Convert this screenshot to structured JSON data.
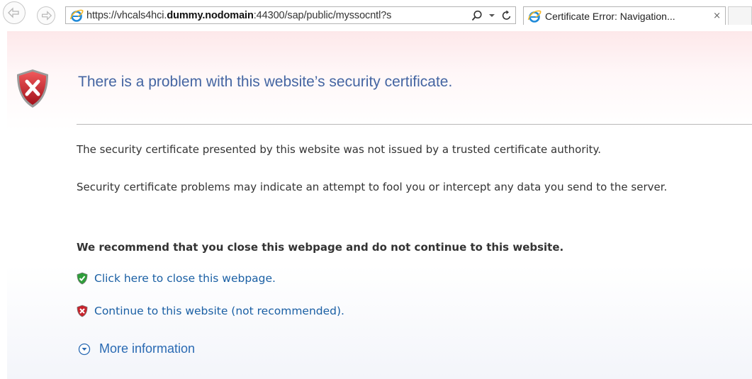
{
  "browser": {
    "url_prefix": "https://vhcals4hci.",
    "url_domain": "dummy.nodomain",
    "url_suffix": ":44300/sap/public/myssocntl?s",
    "tab_title": "Certificate Error: Navigation...",
    "tab_close": "×"
  },
  "page": {
    "title": "There is a problem with this website’s security certificate.",
    "paragraph1": "The security certificate presented by this website was not issued by a trusted certificate authority.",
    "paragraph2": "Security certificate problems may indicate an attempt to fool you or intercept any data you send to the server.",
    "recommendation": "We recommend that you close this webpage and do not continue to this website.",
    "close_link": "Click here to close this webpage.",
    "continue_link": "Continue to this website (not recommended).",
    "more_info": "More information"
  },
  "colors": {
    "title": "#4465a2",
    "link": "#1a5fa4",
    "error_shield": "#c8232c",
    "ok_shield": "#2e9e3a"
  },
  "icons": {
    "back": "back-arrow-icon",
    "forward": "forward-arrow-icon",
    "ie": "internet-explorer-icon",
    "search": "search-icon",
    "dropdown": "chevron-down-icon",
    "refresh": "refresh-icon",
    "error": "error-shield-icon",
    "ok": "green-shield-icon",
    "expand": "expand-circle-icon"
  }
}
